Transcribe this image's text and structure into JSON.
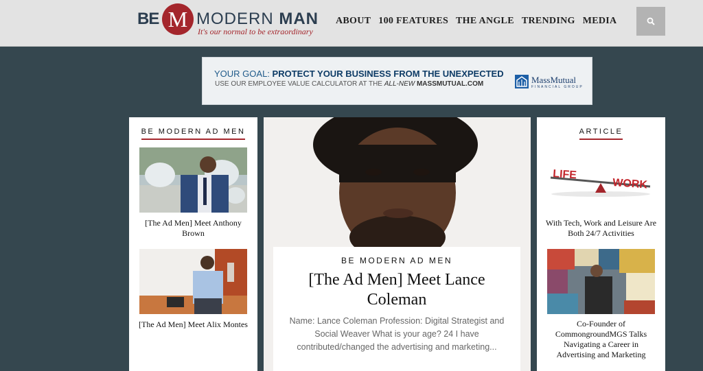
{
  "header": {
    "logo": {
      "be": "BE",
      "m": "M",
      "modern": "MODERN",
      "man": "MAN",
      "tagline": "It's our normal to be extraordinary"
    },
    "nav": [
      "ABOUT",
      "100 FEATURES",
      "THE ANGLE",
      "TRENDING",
      "MEDIA"
    ],
    "search_icon": "search-icon"
  },
  "ad": {
    "line1_prefix": "YOUR GOAL: ",
    "line1_bold": "PROTECT YOUR BUSINESS FROM THE UNEXPECTED",
    "line2_prefix": "USE OUR EMPLOYEE VALUE CALCULATOR AT THE ",
    "line2_italic": "ALL-NEW",
    "line2_bold": " MASSMUTUAL.COM",
    "brand": "MassMutual",
    "brand_sub": "FINANCIAL GROUP"
  },
  "left_column": {
    "title": "BE MODERN AD MEN",
    "items": [
      {
        "caption": "[The Ad Men] Meet Anthony Brown"
      },
      {
        "caption": "[The Ad Men] Meet Alix Montes"
      }
    ]
  },
  "feature": {
    "kicker": "BE MODERN AD MEN",
    "title": "[The Ad Men] Meet Lance Coleman",
    "excerpt": "Name: Lance Coleman Profession: Digital Strategist and Social Weaver What is your age? 24 I have contributed/changed the advertising and marketing..."
  },
  "right_column": {
    "title": "ARTICLE",
    "items": [
      {
        "image_text_left": "LIFE",
        "image_text_right": "WORK",
        "caption": "With Tech, Work and Leisure Are Both 24/7 Activities"
      },
      {
        "caption": "Co-Founder of CommongroundMGS Talks Navigating a Career in Advertising and Marketing"
      }
    ]
  },
  "colors": {
    "brand_red": "#a4262c",
    "navy": "#2c3e50",
    "background": "#35474f"
  }
}
